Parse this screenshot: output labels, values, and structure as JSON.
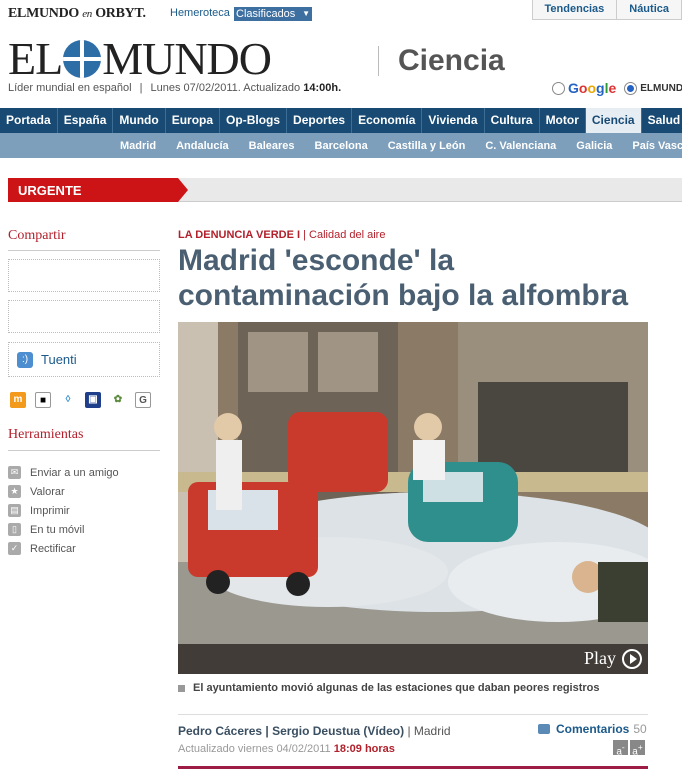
{
  "topbar": {
    "brand_main": "ELMUNDO",
    "brand_en": "en",
    "brand_orbyt": "ORBYT.",
    "hemeroteca": "Hemeroteca",
    "clasificados": "Clasificados",
    "tabs": [
      "Tendencias",
      "Náutica"
    ]
  },
  "masthead": {
    "logo_left": "EL",
    "logo_right": "MUNDO",
    "tagline": "Líder mundial en español",
    "date": "Lunes 07/02/2011. Actualizado",
    "time": "14:00h.",
    "section": "Ciencia",
    "search_google": "Google",
    "search_elmundo": "ELMUNDO"
  },
  "nav": {
    "items": [
      "Portada",
      "España",
      "Mundo",
      "Europa",
      "Op-Blogs",
      "Deportes",
      "Economía",
      "Vivienda",
      "Cultura",
      "Motor",
      "Ciencia",
      "Salud"
    ],
    "active": "Ciencia"
  },
  "subnav": {
    "items": [
      "Madrid",
      "Andalucía",
      "Baleares",
      "Barcelona",
      "Castilla y León",
      "C. Valenciana",
      "Galicia",
      "País Vasco"
    ]
  },
  "urgente": "URGENTE",
  "sidebar": {
    "share_title": "Compartir",
    "tuenti": "Tuenti",
    "tools_title": "Herramientas",
    "tools": [
      "Enviar a un amigo",
      "Valorar",
      "Imprimir",
      "En tu móvil",
      "Rectificar"
    ]
  },
  "article": {
    "kicker": "LA DENUNCIA VERDE I",
    "category": "| Calidad del aire",
    "headline": "Madrid 'esconde' la contaminación bajo la alfombra",
    "play_label": "Play",
    "caption": "El ayuntamiento movió algunas de las estaciones que daban peores registros",
    "authors": "Pedro Cáceres | Sergio Deustua (Vídeo)",
    "location": "| Madrid",
    "updated_label": "Actualizado viernes 04/02/2011",
    "updated_time": "18:09 horas",
    "comments_label": "Comentarios",
    "comments_count": "50",
    "font_smaller": "a",
    "font_larger": "a"
  },
  "colors": {
    "nav_bg": "#184a73",
    "subnav_bg": "#7d9fbb",
    "urgente_red": "#cc1416",
    "accent_red": "#b2202b",
    "headline": "#4a5f72"
  }
}
